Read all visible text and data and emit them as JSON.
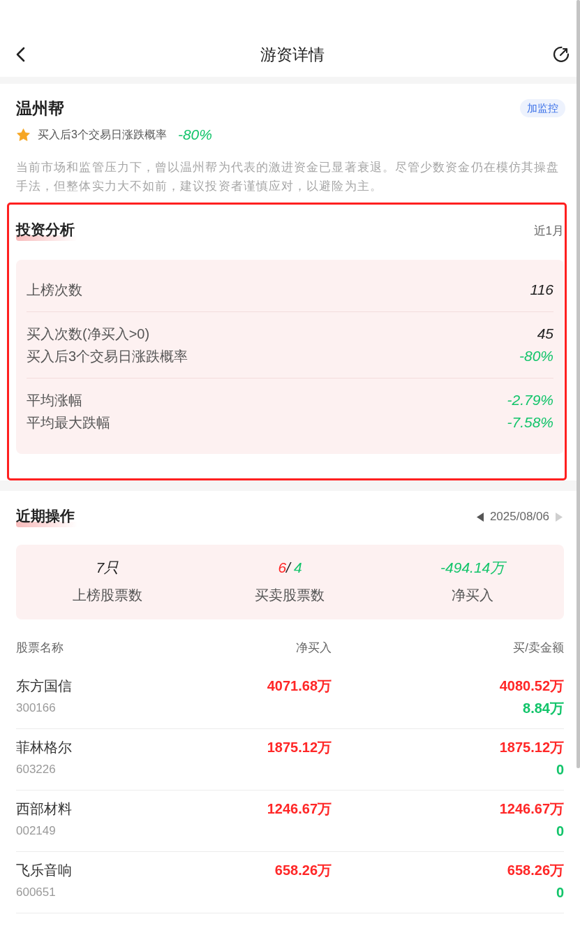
{
  "header": {
    "title": "游资详情"
  },
  "profile": {
    "name": "温州帮",
    "monitor_button": "加监控",
    "probability_label": "买入后3个交易日涨跌概率",
    "probability_value": "-80%",
    "description": "当前市场和监管压力下，曾以温州帮为代表的激进资金已显著衰退。尽管少数资金仍在模仿其操盘手法，但整体实力大不如前，建议投资者谨慎应对，以避险为主。"
  },
  "analysis": {
    "highlighted": true,
    "title": "投资分析",
    "period": "近1月",
    "groups": [
      {
        "rows": [
          {
            "label": "上榜次数",
            "value": "116",
            "color": "#222222"
          }
        ]
      },
      {
        "rows": [
          {
            "label": "买入次数(净买入>0)",
            "value": "45",
            "color": "#222222"
          },
          {
            "label": "买入后3个交易日涨跌概率",
            "value": "-80%",
            "color": "#12c46a"
          }
        ]
      },
      {
        "rows": [
          {
            "label": "平均涨幅",
            "value": "-2.79%",
            "color": "#12c46a"
          },
          {
            "label": "平均最大跌幅",
            "value": "-7.58%",
            "color": "#12c46a"
          }
        ]
      }
    ]
  },
  "recent": {
    "title": "近期操作",
    "date_nav": {
      "date": "2025/08/06",
      "prev_disabled": false,
      "next_disabled": true
    },
    "summary": [
      {
        "kind": "single",
        "value": "7只",
        "color": "#222222",
        "label": "上榜股票数"
      },
      {
        "kind": "split",
        "buy": "6",
        "separator": "/",
        "sell": "4",
        "label": "买卖股票数"
      },
      {
        "kind": "single",
        "value": "-494.14万",
        "color": "#12c46a",
        "label": "净买入"
      }
    ],
    "table": {
      "columns": [
        "股票名称",
        "净买入",
        "买/卖金额"
      ],
      "rows": [
        {
          "name": "东方国信",
          "code": "300166",
          "net_buy": "4071.68万",
          "buy_amount": "4080.52万",
          "sell_amount": "8.84万"
        },
        {
          "name": "菲林格尔",
          "code": "603226",
          "net_buy": "1875.12万",
          "buy_amount": "1875.12万",
          "sell_amount": "0"
        },
        {
          "name": "西部材料",
          "code": "002149",
          "net_buy": "1246.67万",
          "buy_amount": "1246.67万",
          "sell_amount": "0"
        },
        {
          "name": "飞乐音响",
          "code": "600651",
          "net_buy": "658.26万",
          "buy_amount": "658.26万",
          "sell_amount": "0"
        }
      ]
    }
  }
}
